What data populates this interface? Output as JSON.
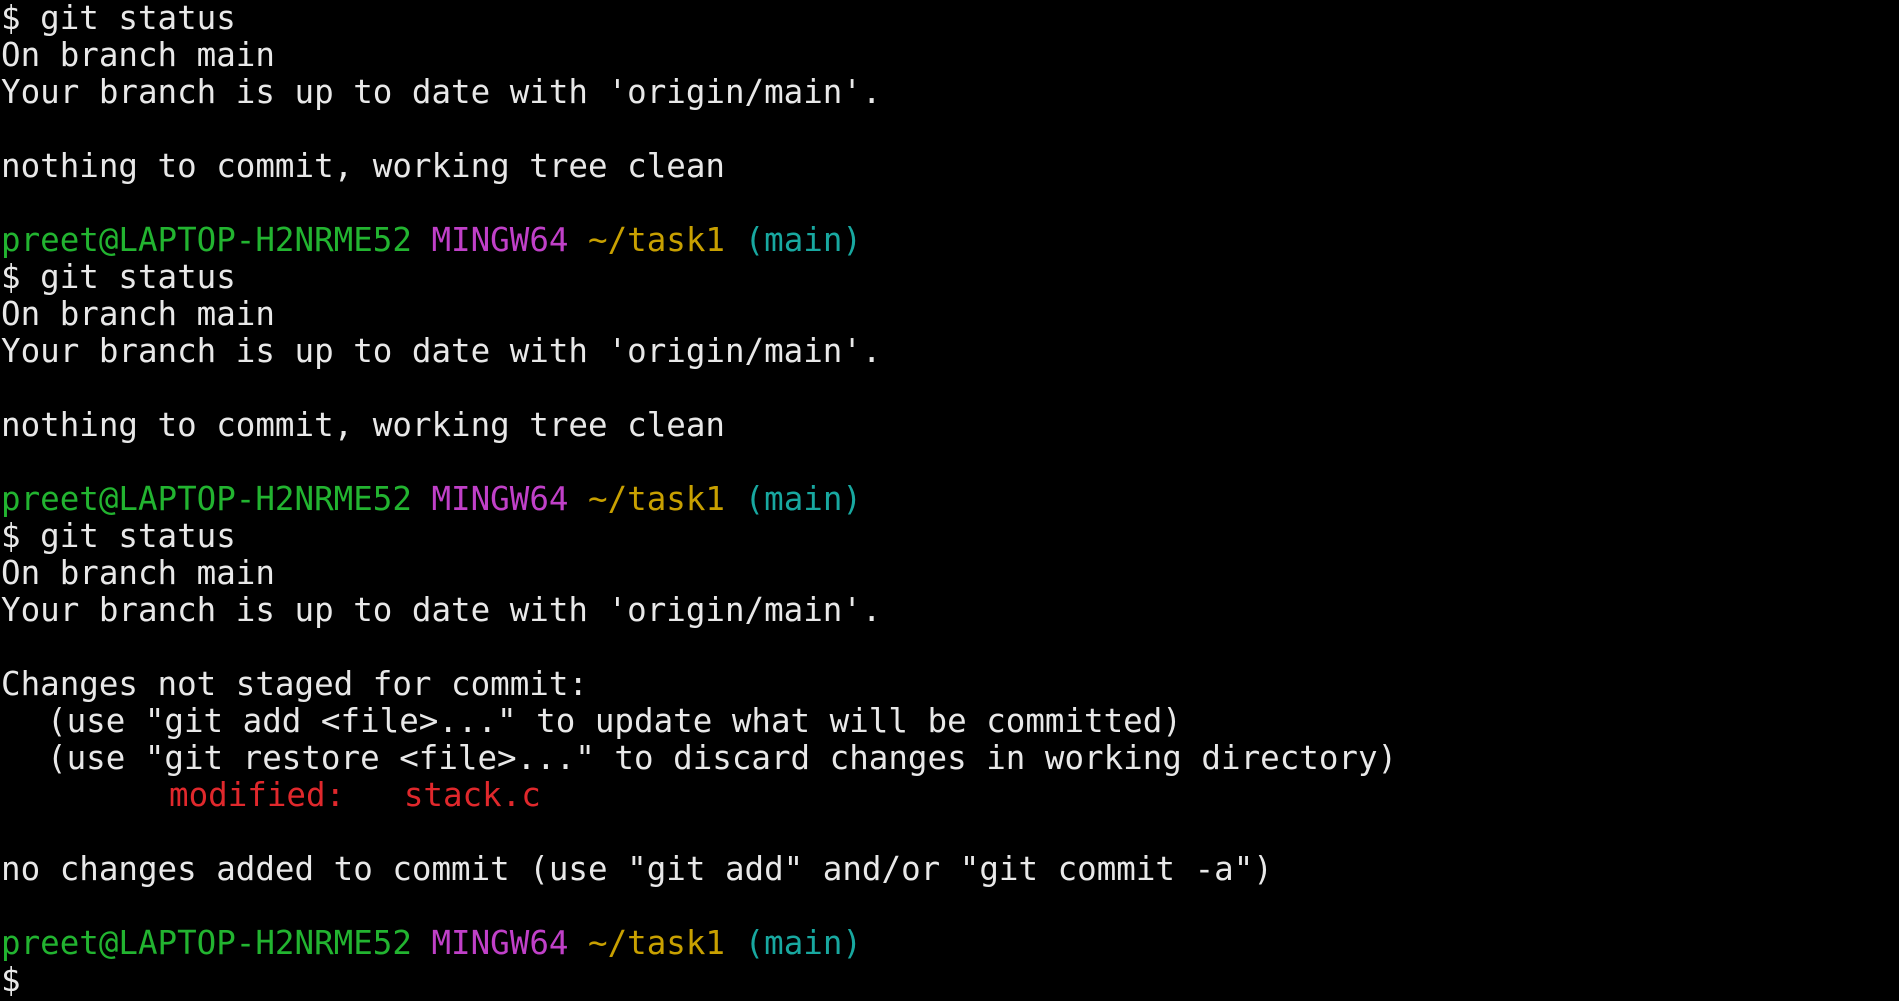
{
  "colors": {
    "background": "#000000",
    "text": "#e8e8e8",
    "user_host": "#22b430",
    "environment": "#c040c8",
    "path": "#c8a000",
    "branch": "#18a8a0",
    "modified": "#e0282c"
  },
  "prompt": {
    "user_host": "preet@LAPTOP-H2NRME52",
    "environment": "MINGW64",
    "path": "~/task1",
    "branch": "(main)",
    "symbol": "$"
  },
  "blocks": [
    {
      "command": "$ git status",
      "lines": [
        "On branch main",
        "Your branch is up to date with 'origin/main'.",
        "",
        "nothing to commit, working tree clean"
      ]
    },
    {
      "command": "$ git status",
      "lines": [
        "On branch main",
        "Your branch is up to date with 'origin/main'.",
        "",
        "nothing to commit, working tree clean"
      ]
    },
    {
      "command": "$ git status",
      "lines": [
        "On branch main",
        "Your branch is up to date with 'origin/main'.",
        "",
        "Changes not staged for commit:"
      ],
      "hints": [
        "(use \"git add <file>...\" to update what will be committed)",
        "(use \"git restore <file>...\" to discard changes in working directory)"
      ],
      "modified": {
        "label": "modified:",
        "file": "stack.c"
      },
      "summary": "no changes added to commit (use \"git add\" and/or \"git commit -a\")"
    }
  ],
  "final_prompt": "$"
}
